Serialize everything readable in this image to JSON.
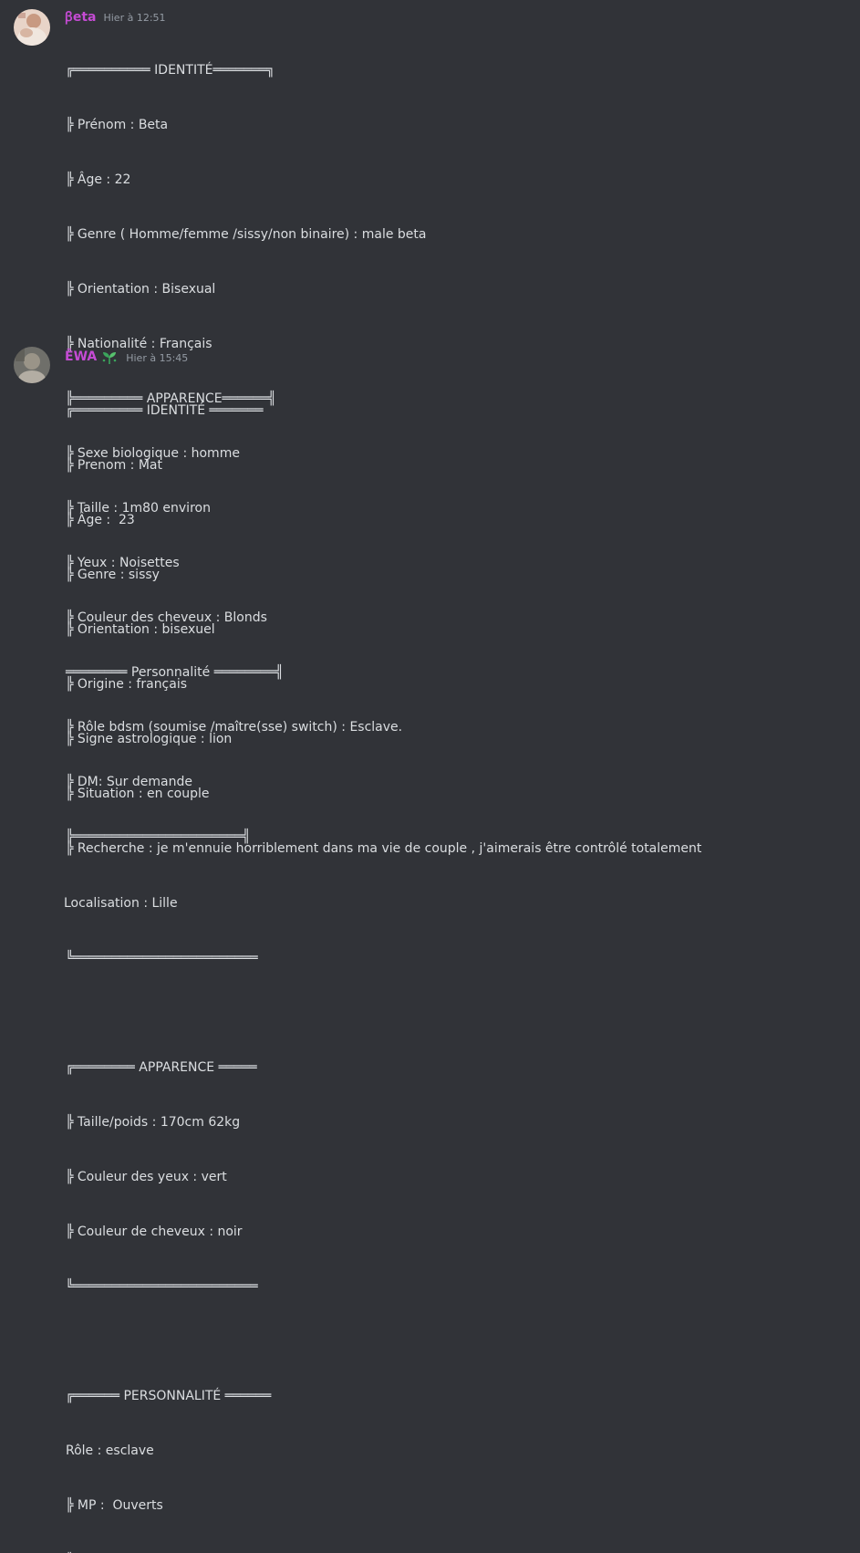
{
  "messages": [
    {
      "username": "ꞵeta",
      "timestamp": "Hier à 12:51",
      "avatar_icon": "avatar-image",
      "lines": [
        "╔══════════ IDENTITÉ═══════╗",
        "╠ Prénom : Beta",
        "╠ Âge : 22",
        "╠ Genre ( Homme/femme /sissy/non binaire) : male beta",
        "╠ Orientation : Bisexual",
        "╠ Nationalité : Français",
        "╠═════════ APPARENCE══════╣",
        "╠ Sexe biologique : homme",
        "╠ Taille : 1m80 environ",
        "╠ Yeux : Noisettes",
        "╠ Couleur des cheveux : Blonds",
        "════════ Personnalité ════════╣",
        "╠ Rôle bdsm (soumise /maître(sse) switch) : Esclave.",
        "╠ DM: Sur demande",
        "╠══════════════════════╣"
      ]
    },
    {
      "username": "ĒWA",
      "timestamp": "Hier à 15:45",
      "avatar_icon": "avatar-image",
      "badge_icon": "sprout-icon",
      "lines": [
        "╔═════════ IDENTITÉ ═══════",
        "╠ Prenom : Mat",
        "╠ Âge :  23",
        "╠ Genre : sissy",
        "╠ Orientation : bisexuel",
        "╠ Origine : français",
        "╠ Signe astrologique : lion",
        "╠ Situation : en couple",
        "╠ Recherche : je m'ennuie horriblement dans ma vie de couple , j'aimerais être contrôlé totalement",
        "Localisation : Lille",
        "╚════════════════════════",
        "",
        "╔════════ APPARENCE ═════",
        "╠ Taille/poids : 170cm 62kg",
        "╠ Couleur des yeux : vert",
        "╠ Couleur de cheveux : noir",
        "╚════════════════════════",
        "",
        "╔══════ PERSONNALITÉ ══════",
        "Rôle : esclave",
        "╠ MP :  Ouverts",
        "╚════════════════════════"
      ]
    }
  ],
  "colors": {
    "background": "#313338",
    "username": "#c54bd4",
    "text": "#dbdee1",
    "timestamp": "#949ba4"
  }
}
